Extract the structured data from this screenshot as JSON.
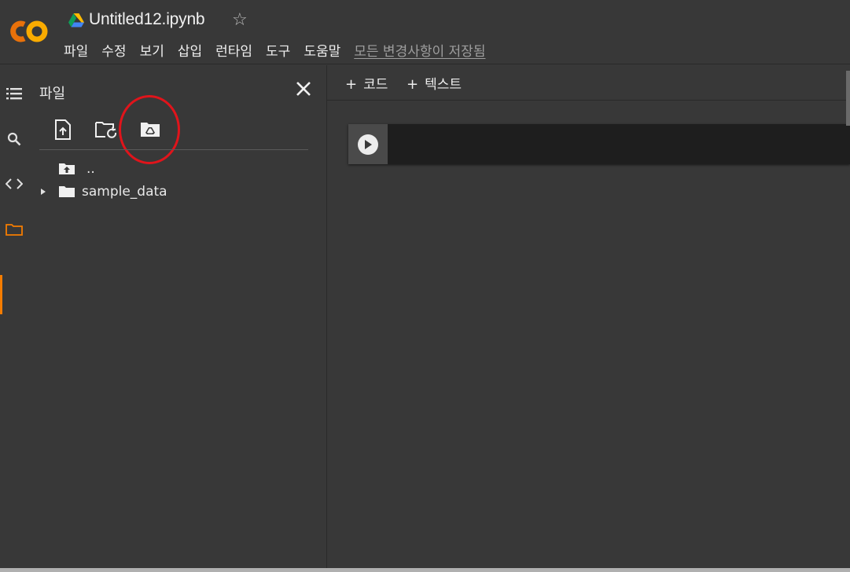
{
  "app": {
    "logo_text": "CO",
    "notebook_title": "Untitled12.ipynb",
    "brand_color": "#f9ab00",
    "brand_color_2": "#e8710a"
  },
  "menu": {
    "items": [
      {
        "label": "파일"
      },
      {
        "label": "수정"
      },
      {
        "label": "보기"
      },
      {
        "label": "삽입"
      },
      {
        "label": "런타임"
      },
      {
        "label": "도구"
      },
      {
        "label": "도움말"
      }
    ],
    "save_status": "모든 변경사항이 저장됨"
  },
  "rail": {
    "items": [
      {
        "icon": "table-of-contents-icon"
      },
      {
        "icon": "search-icon"
      },
      {
        "icon": "code-snippets-icon"
      },
      {
        "icon": "folder-icon",
        "active": true
      }
    ],
    "active_color": "#f57c00"
  },
  "files_panel": {
    "title": "파일",
    "toolbar": [
      {
        "icon": "upload-file-icon"
      },
      {
        "icon": "refresh-folder-icon"
      },
      {
        "icon": "mount-drive-icon"
      }
    ],
    "tree": [
      {
        "name": "..",
        "icon": "parent-folder-icon"
      },
      {
        "name": "sample_data",
        "icon": "folder-icon",
        "expandable": true
      }
    ],
    "annotation_color": "#e0141b"
  },
  "notebook": {
    "add_code_label": "코드",
    "add_text_label": "텍스트",
    "plus_symbol": "+"
  }
}
